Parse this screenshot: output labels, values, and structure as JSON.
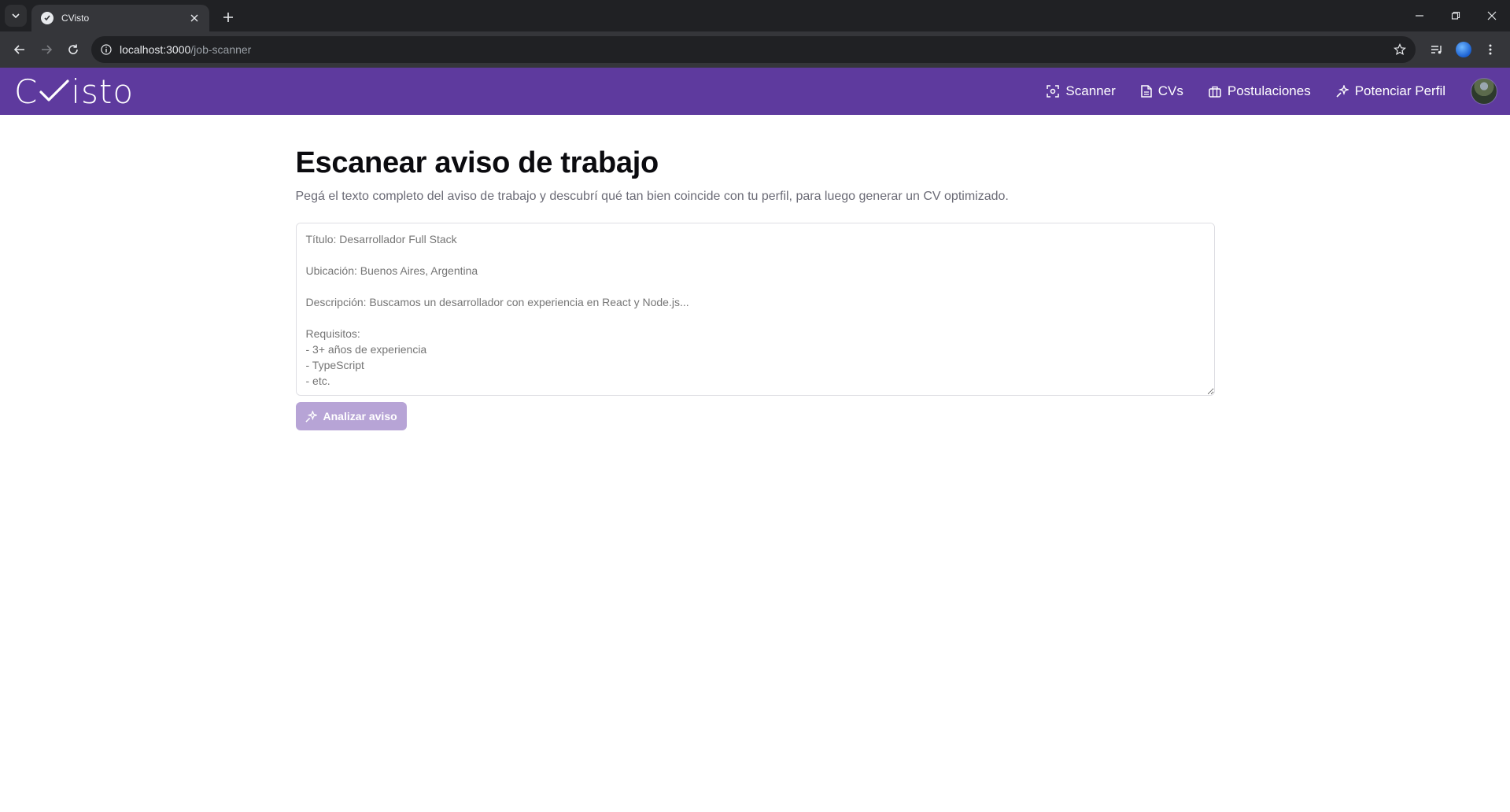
{
  "browser": {
    "tab_title": "CVisto",
    "url_host": "localhost:3000",
    "url_path": "/job-scanner"
  },
  "header": {
    "logo_left": "C",
    "logo_right": "isto",
    "nav": [
      {
        "label": "Scanner",
        "icon": "scan-icon"
      },
      {
        "label": "CVs",
        "icon": "document-icon"
      },
      {
        "label": "Postulaciones",
        "icon": "briefcase-icon"
      },
      {
        "label": "Potenciar Perfil",
        "icon": "sparkles-icon"
      }
    ]
  },
  "main": {
    "title": "Escanear aviso de trabajo",
    "subtitle": "Pegá el texto completo del aviso de trabajo y descubrí qué tan bien coincide con tu perfil, para luego generar un CV optimizado.",
    "textarea_placeholder": "Título: Desarrollador Full Stack\n\nUbicación: Buenos Aires, Argentina\n\nDescripción: Buscamos un desarrollador con experiencia en React y Node.js...\n\nRequisitos:\n- 3+ años de experiencia\n- TypeScript\n- etc.",
    "textarea_value": "",
    "analyze_label": "Analizar aviso"
  },
  "colors": {
    "header_bg": "#5e3a9e",
    "button_disabled": "#b7a4d6"
  }
}
